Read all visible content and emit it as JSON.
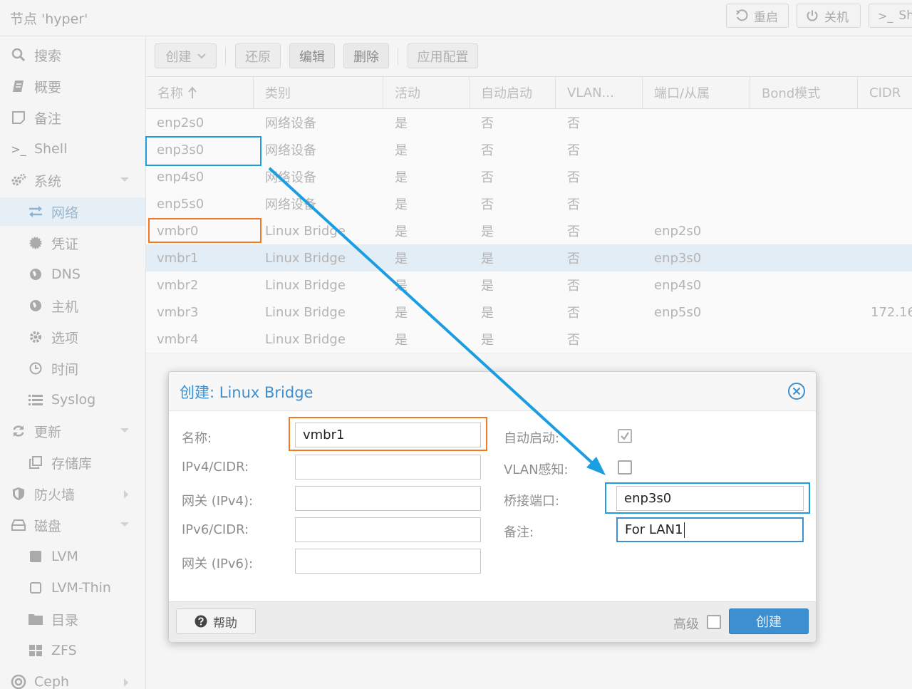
{
  "header": {
    "node_title": "节点 'hyper'",
    "restart_label": "重启",
    "shutdown_label": "关机",
    "shell_label": "Sh"
  },
  "sidebar": {
    "items": [
      {
        "label": "搜索",
        "icon": "search-icon"
      },
      {
        "label": "概要",
        "icon": "book-icon"
      },
      {
        "label": "备注",
        "icon": "note-icon"
      },
      {
        "label": "Shell",
        "icon": "terminal-icon"
      },
      {
        "label": "系统",
        "icon": "cogs-icon",
        "expandable": true
      },
      {
        "label": "网络",
        "icon": "exchange-icon",
        "selected": true
      },
      {
        "label": "凭证",
        "icon": "certificate-icon"
      },
      {
        "label": "DNS",
        "icon": "globe-icon"
      },
      {
        "label": "主机",
        "icon": "globe-icon"
      },
      {
        "label": "选项",
        "icon": "gear-icon"
      },
      {
        "label": "时间",
        "icon": "clock-icon"
      },
      {
        "label": "Syslog",
        "icon": "list-icon"
      },
      {
        "label": "更新",
        "icon": "refresh-icon",
        "expandable": true
      },
      {
        "label": "存储库",
        "icon": "copy-icon"
      },
      {
        "label": "防火墙",
        "icon": "shield-icon",
        "expandable": true
      },
      {
        "label": "磁盘",
        "icon": "hdd-icon",
        "expandable": true
      },
      {
        "label": "LVM",
        "icon": "square-icon"
      },
      {
        "label": "LVM-Thin",
        "icon": "square-outline-icon"
      },
      {
        "label": "目录",
        "icon": "folder-icon"
      },
      {
        "label": "ZFS",
        "icon": "grid-icon"
      },
      {
        "label": "Ceph",
        "icon": "ceph-icon",
        "expandable": true
      }
    ]
  },
  "toolbar": {
    "create_label": "创建",
    "revert_label": "还原",
    "edit_label": "编辑",
    "delete_label": "删除",
    "apply_label": "应用配置"
  },
  "grid": {
    "columns": [
      "名称",
      "类别",
      "活动",
      "自动启动",
      "VLAN...",
      "端口/从属",
      "Bond模式",
      "CIDR"
    ],
    "rows": [
      {
        "name": "enp2s0",
        "type": "网络设备",
        "active": "是",
        "autostart": "否",
        "vlan": "否",
        "ports": "",
        "bond": "",
        "cidr": ""
      },
      {
        "name": "enp3s0",
        "type": "网络设备",
        "active": "是",
        "autostart": "否",
        "vlan": "否",
        "ports": "",
        "bond": "",
        "cidr": ""
      },
      {
        "name": "enp4s0",
        "type": "网络设备",
        "active": "是",
        "autostart": "否",
        "vlan": "否",
        "ports": "",
        "bond": "",
        "cidr": ""
      },
      {
        "name": "enp5s0",
        "type": "网络设备",
        "active": "是",
        "autostart": "否",
        "vlan": "否",
        "ports": "",
        "bond": "",
        "cidr": ""
      },
      {
        "name": "vmbr0",
        "type": "Linux Bridge",
        "active": "是",
        "autostart": "是",
        "vlan": "否",
        "ports": "enp2s0",
        "bond": "",
        "cidr": ""
      },
      {
        "name": "vmbr1",
        "type": "Linux Bridge",
        "active": "是",
        "autostart": "是",
        "vlan": "否",
        "ports": "enp3s0",
        "bond": "",
        "cidr": "",
        "selected": true
      },
      {
        "name": "vmbr2",
        "type": "Linux Bridge",
        "active": "是",
        "autostart": "是",
        "vlan": "否",
        "ports": "enp4s0",
        "bond": "",
        "cidr": ""
      },
      {
        "name": "vmbr3",
        "type": "Linux Bridge",
        "active": "是",
        "autostart": "是",
        "vlan": "否",
        "ports": "enp5s0",
        "bond": "",
        "cidr": "172.16"
      },
      {
        "name": "vmbr4",
        "type": "Linux Bridge",
        "active": "是",
        "autostart": "是",
        "vlan": "否",
        "ports": "",
        "bond": "",
        "cidr": ""
      }
    ]
  },
  "dialog": {
    "title": "创建: Linux Bridge",
    "name_label": "名称:",
    "name_value": "vmbr1",
    "ipv4_label": "IPv4/CIDR:",
    "ipv4_value": "",
    "gw4_label": "网关 (IPv4):",
    "gw4_value": "",
    "ipv6_label": "IPv6/CIDR:",
    "ipv6_value": "",
    "gw6_label": "网关 (IPv6):",
    "gw6_value": "",
    "autostart_label": "自动启动:",
    "autostart_checked": true,
    "vlan_label": "VLAN感知:",
    "vlan_checked": false,
    "bridge_ports_label": "桥接端口:",
    "bridge_ports_value": "enp3s0",
    "comment_label": "备注:",
    "comment_value": "For LAN1",
    "help_label": "帮助",
    "advanced_label": "高级",
    "advanced_checked": false,
    "create_label": "创建"
  },
  "colors": {
    "accent": "#3d8fd0",
    "highlight_orange": "#f07a23",
    "highlight_blue": "#1a9ee0",
    "selected_row": "#e3edf6"
  }
}
